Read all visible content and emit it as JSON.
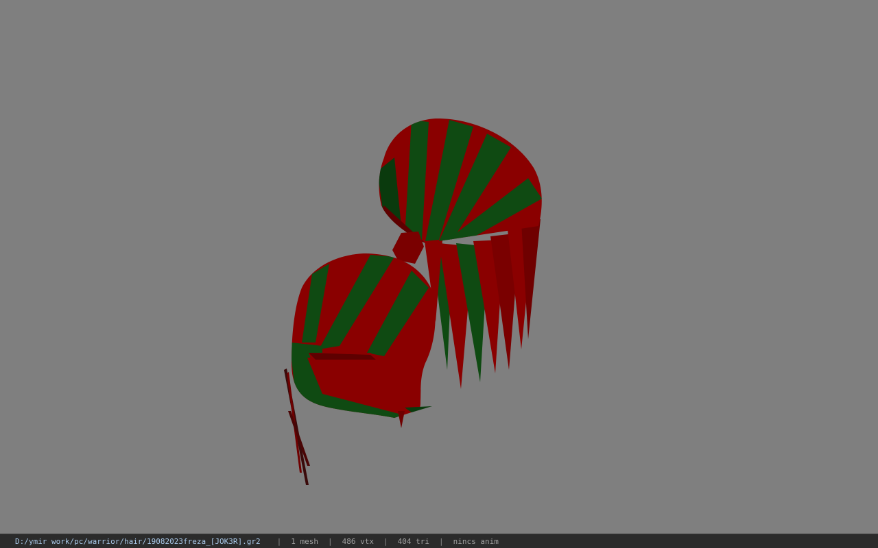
{
  "viewport": {
    "background_color": "#7f7f7f",
    "model_colors": {
      "red": "#8a0000",
      "dark_red": "#5e0000",
      "green": "#0f4a12",
      "dark_green": "#0a3a0d"
    }
  },
  "statusbar": {
    "file_path": "D:/ymir work/pc/warrior/hair/19082023freza_[JOK3R].gr2",
    "separator": "|",
    "mesh_count": "1 mesh",
    "vertex_count": "486 vtx",
    "triangle_count": "404 tri",
    "anim_status": "nincs anim"
  }
}
